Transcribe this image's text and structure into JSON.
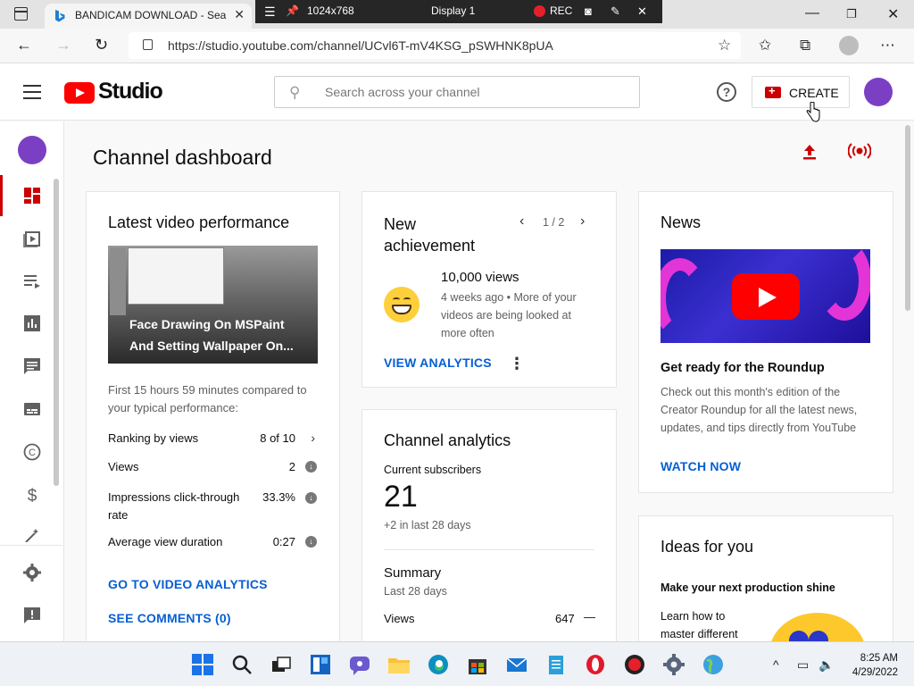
{
  "browser": {
    "tab_title": "BANDICAM DOWNLOAD - Search",
    "url": "https://studio.youtube.com/channel/UCvl6T-mV4KSG_pSWHNK8pUA"
  },
  "bandicam": {
    "resolution": "1024x768",
    "display": "Display 1",
    "rec_label": "REC"
  },
  "header": {
    "logo_text": "Studio",
    "search_placeholder": "Search across your channel",
    "create_label": "CREATE"
  },
  "page": {
    "title": "Channel dashboard"
  },
  "latest_video": {
    "title": "Latest video performance",
    "video_title": "Face Drawing On MSPaint And Setting Wallpaper On...",
    "compare_text": "First 15 hours 59 minutes compared to your typical performance:",
    "rows": [
      {
        "label": "Ranking by views",
        "value": "8 of 10"
      },
      {
        "label": "Views",
        "value": "2"
      },
      {
        "label": "Impressions click-through rate",
        "value": "33.3%"
      },
      {
        "label": "Average view duration",
        "value": "0:27"
      }
    ],
    "analytics_link": "GO TO VIDEO ANALYTICS",
    "comments_link": "SEE COMMENTS (0)"
  },
  "achievement": {
    "title": "New achievement",
    "pager": "1 / 2",
    "headline": "10,000 views",
    "description": "4 weeks ago • More of your videos are being looked at more often",
    "link": "VIEW ANALYTICS"
  },
  "channel_analytics": {
    "title": "Channel analytics",
    "subs_label": "Current subscribers",
    "subs_value": "21",
    "subs_change": "+2 in last 28 days",
    "summary_title": "Summary",
    "summary_period": "Last 28 days",
    "views_label": "Views",
    "views_value": "647",
    "views_trend": "—"
  },
  "news": {
    "title": "News",
    "headline": "Get ready for the Roundup",
    "body": "Check out this month's edition of the Creator Roundup for all the latest news, updates, and tips directly from YouTube",
    "link": "WATCH NOW"
  },
  "ideas": {
    "title": "Ideas for you",
    "subtitle": "Make your next production shine",
    "body": "Learn how to master different"
  },
  "taskbar": {
    "time": "8:25 AM",
    "date": "4/29/2022"
  }
}
